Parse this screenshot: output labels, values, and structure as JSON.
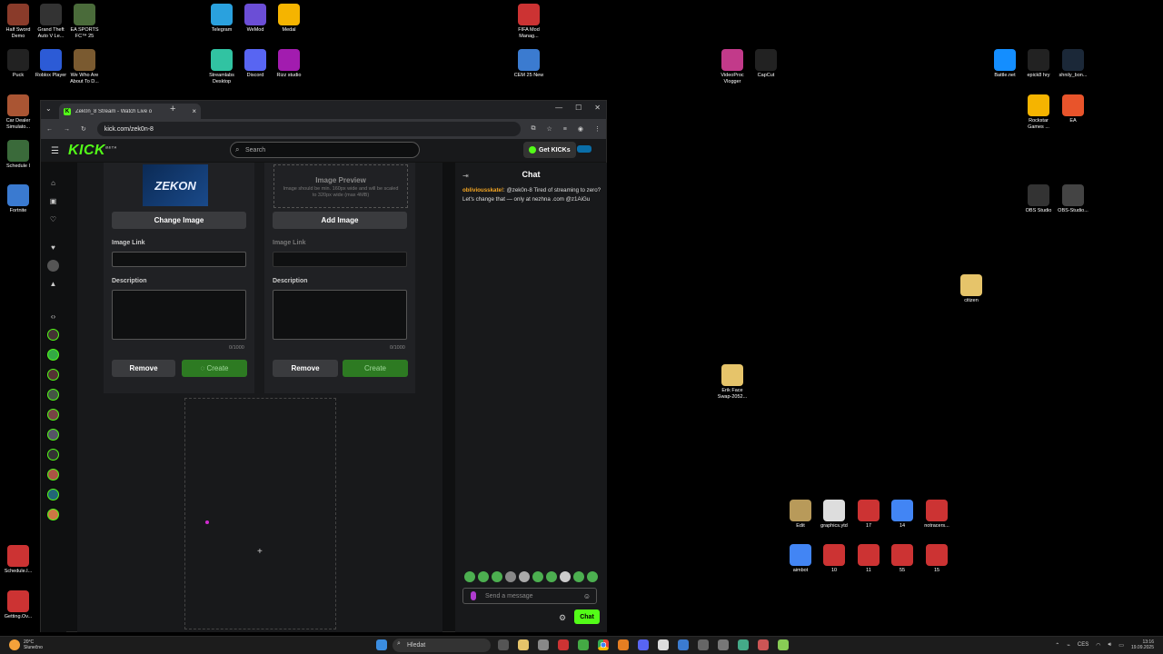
{
  "desktop": {
    "icons_left": [
      {
        "label": "Half Sword\nDemo",
        "color": "#8a3b2a"
      },
      {
        "label": "Grand Theft\nAuto V Le...",
        "color": "#333"
      },
      {
        "label": "EA SPORTS\nFC™ 25",
        "color": "#4a6b3a"
      },
      {
        "label": "Puck",
        "color": "#222"
      },
      {
        "label": "Roblox Player",
        "color": "#2c5bd6"
      },
      {
        "label": "We Who Are\nAbout To D...",
        "color": "#7a5a30"
      },
      {
        "label": "Car Dealer\nSimulato...",
        "color": "#a53"
      },
      {
        "label": "Schedule I",
        "color": "#3a6a3a"
      },
      {
        "label": "Fortnite",
        "color": "#3a7ad0"
      },
      {
        "label": "Schedule.I...",
        "color": "#c33"
      },
      {
        "label": "Getting.Ov...",
        "color": "#c33"
      }
    ],
    "icons_top": [
      {
        "label": "Telegram",
        "color": "#2aa1de"
      },
      {
        "label": "WeMod",
        "color": "#6b4ed6"
      },
      {
        "label": "Medal",
        "color": "#f5b400"
      },
      {
        "label": "Streamlabs\nDesktop",
        "color": "#31c3a2"
      },
      {
        "label": "Discord",
        "color": "#5865f2"
      },
      {
        "label": "Rizz studio",
        "color": "#a21caf"
      },
      {
        "label": "FIFA Mod\nManag...",
        "color": "#c33"
      },
      {
        "label": "CEM 25 New",
        "color": "#3b7bd0"
      },
      {
        "label": "VideoProc\nVlogger",
        "color": "#c23a8a"
      },
      {
        "label": "CapCut",
        "color": "#222"
      }
    ],
    "icons_right": [
      {
        "label": "Battle.net",
        "color": "#148eff"
      },
      {
        "label": "epick8 hry",
        "color": "#222"
      },
      {
        "label": "shnily_bon...",
        "color": "#1b2838"
      },
      {
        "label": "Rockstar\nGames ...",
        "color": "#f5b400"
      },
      {
        "label": "EA",
        "color": "#e8542b"
      },
      {
        "label": "OBS Studio",
        "color": "#333"
      },
      {
        "label": "OBS-Studio...",
        "color": "#444"
      },
      {
        "label": "citizen",
        "color": "#e6c46a"
      },
      {
        "label": "Erik Face\nSwap-2052...",
        "color": "#e6c46a"
      }
    ],
    "icons_bottom": [
      {
        "label": "Edit",
        "color": "#b89a5a"
      },
      {
        "label": "graphics.ytd",
        "color": "#ddd"
      },
      {
        "label": "17",
        "color": "#c33"
      },
      {
        "label": "14",
        "color": "#4285f4"
      },
      {
        "label": "notracers...",
        "color": "#c33"
      },
      {
        "label": "aimbot",
        "color": "#4285f4"
      },
      {
        "label": "10",
        "color": "#c33"
      },
      {
        "label": "11",
        "color": "#c33"
      },
      {
        "label": "55",
        "color": "#c33"
      },
      {
        "label": "15",
        "color": "#c33"
      }
    ]
  },
  "browser": {
    "tab_title": "Zek0n_8 Stream - Watch Live o",
    "url": "kick.com/zek0n-8"
  },
  "kick": {
    "logo": "KICK",
    "logo_badge": "BETA",
    "search_placeholder": "Search",
    "get_kicks": "Get KICKs",
    "card1": {
      "image_text": "ZEKON",
      "change_image": "Change Image",
      "image_link_label": "Image Link",
      "description_label": "Description",
      "counter": "0/1000",
      "remove": "Remove",
      "create": "Create"
    },
    "card2": {
      "preview_title": "Image Preview",
      "preview_sub": "Image should be min. 160px wide and will be scaled to 320px wide (max 4MB)",
      "add_image": "Add Image",
      "image_link_label": "Image Link",
      "description_label": "Description",
      "counter": "0/1000",
      "remove": "Remove",
      "create": "Create"
    },
    "chat": {
      "title": "Chat",
      "message_user": "obliviousskate!",
      "message_text": ": @zek0n-8 Tired of streaming to zero? Let's change that — only at nezhna .com @z1AiGu",
      "input_placeholder": "Send a message",
      "send_button": "Chat"
    }
  },
  "taskbar": {
    "weather_temp": "20°C",
    "weather_desc": "Slunečno",
    "search_placeholder": "Hledat",
    "lang": "CES",
    "time": "13:16",
    "date": "19.09.2025"
  }
}
